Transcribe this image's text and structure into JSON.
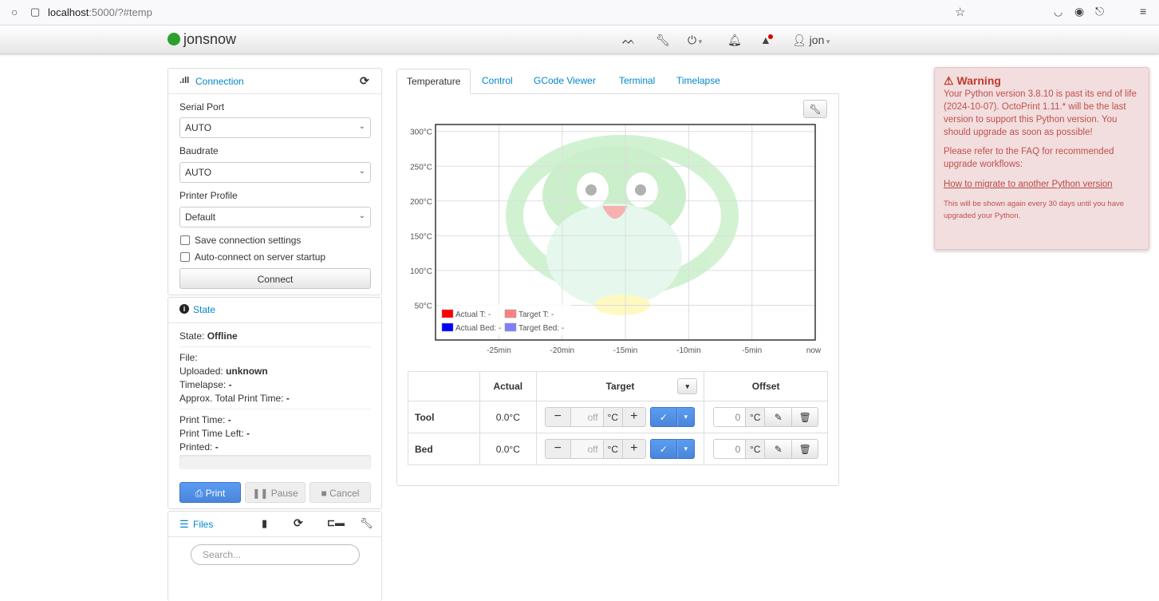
{
  "browser": {
    "url_host": "localhost",
    "url_rest": ":5000/?#temp"
  },
  "navbar": {
    "brand": "jonsnow",
    "user": "jon",
    "icons": [
      "eye-slash-icon",
      "wrench-icon",
      "power-icon",
      "bell-icon",
      "alert-icon",
      "user-icon"
    ]
  },
  "connection": {
    "title": "Connection",
    "serial_port_label": "Serial Port",
    "serial_port_value": "AUTO",
    "baudrate_label": "Baudrate",
    "baudrate_value": "AUTO",
    "profile_label": "Printer Profile",
    "profile_value": "Default",
    "save_settings": "Save connection settings",
    "autoconnect": "Auto-connect on server startup",
    "connect_button": "Connect"
  },
  "state": {
    "title": "State",
    "state_label": "State:",
    "state_value": "Offline",
    "file_label": "File:",
    "uploaded_label": "Uploaded:",
    "uploaded_value": "unknown",
    "timelapse_label": "Timelapse:",
    "timelapse_value": "-",
    "approx_label": "Approx. Total Print Time:",
    "approx_value": "-",
    "print_time_label": "Print Time:",
    "print_time_value": "-",
    "print_time_left_label": "Print Time Left:",
    "print_time_left_value": "-",
    "printed_label": "Printed:",
    "printed_value": "-",
    "progress": 0,
    "print_button": "Print",
    "pause_button": "Pause",
    "cancel_button": "Cancel"
  },
  "files": {
    "title": "Files",
    "search_placeholder": "Search..."
  },
  "tabs": [
    {
      "label": "Temperature"
    },
    {
      "label": "Control"
    },
    {
      "label": "GCode Viewer"
    },
    {
      "label": "Terminal"
    },
    {
      "label": "Timelapse"
    }
  ],
  "chart_data": {
    "type": "line",
    "x_ticks": [
      "-25min",
      "-20min",
      "-15min",
      "-10min",
      "-5min",
      "now"
    ],
    "y_ticks": [
      "50°C",
      "100°C",
      "150°C",
      "200°C",
      "250°C",
      "300°C"
    ],
    "ylim": [
      0,
      310
    ],
    "grid": true,
    "legend_position": "bottom-left",
    "series": [
      {
        "name": "Actual T:",
        "value": "-",
        "color": "#ff0000",
        "values": []
      },
      {
        "name": "Target T:",
        "value": "-",
        "color": "#ff8080",
        "values": []
      },
      {
        "name": "Actual Bed:",
        "value": "-",
        "color": "#0000ff",
        "values": []
      },
      {
        "name": "Target Bed:",
        "value": "-",
        "color": "#8080ff",
        "values": []
      }
    ]
  },
  "temp_table": {
    "headers": {
      "actual": "Actual",
      "target": "Target",
      "offset": "Offset"
    },
    "rows": [
      {
        "name": "Tool",
        "actual": "0.0°C",
        "target_placeholder": "off",
        "unit": "°C",
        "offset": "0"
      },
      {
        "name": "Bed",
        "actual": "0.0°C",
        "target_placeholder": "off",
        "unit": "°C",
        "offset": "0"
      }
    ]
  },
  "warning": {
    "title": "Warning",
    "body1": "Your Python version 3.8.10 is past its end of life (2024-10-07). OctoPrint 1.11.* will be the last version to support this Python version. You should upgrade as soon as possible!",
    "body2": "Please refer to the FAQ for recommended upgrade workflows:",
    "link": "How to migrate to another Python version",
    "footer": "This will be shown again every 30 days until you have upgraded your Python."
  }
}
